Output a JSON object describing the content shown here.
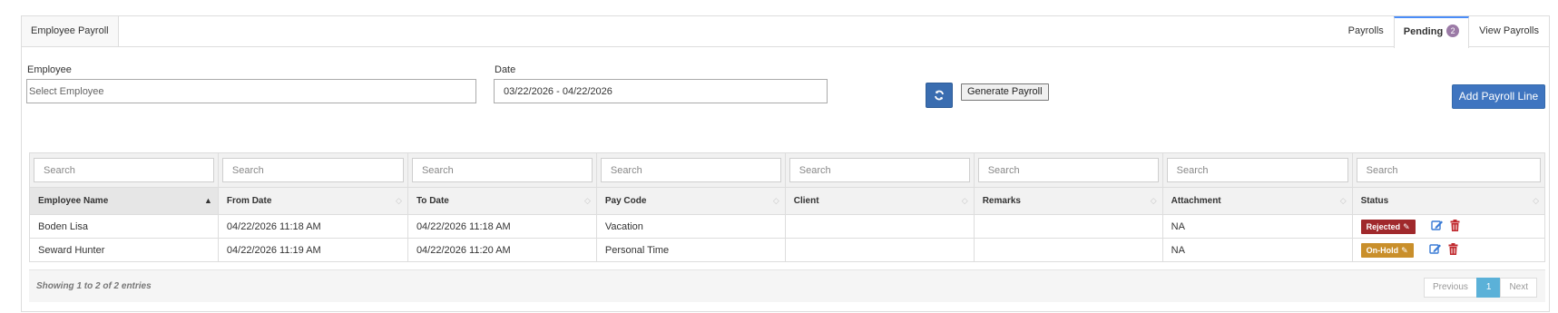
{
  "panel": {
    "title": "Employee Payroll",
    "tabs": [
      {
        "label": "Payrolls"
      },
      {
        "label": "Pending",
        "badge": "2"
      },
      {
        "label": "View Payrolls"
      }
    ]
  },
  "filters": {
    "employee_label": "Employee",
    "employee_placeholder": "Select Employee",
    "date_label": "Date",
    "date_value": "03/22/2026 - 04/22/2026",
    "generate_label": "Generate Payroll",
    "add_label": "Add Payroll Line"
  },
  "table": {
    "search_placeholder": "Search",
    "columns": [
      "Employee Name",
      "From Date",
      "To Date",
      "Pay Code",
      "Client",
      "Remarks",
      "Attachment",
      "Status"
    ],
    "rows": [
      {
        "employee": "Boden Lisa",
        "from": "04/22/2026 11:18 AM",
        "to": "04/22/2026 11:18 AM",
        "paycode": "Vacation",
        "client": "",
        "remarks": "",
        "attachment": "NA",
        "status": "Rejected",
        "status_color": "#a0292c"
      },
      {
        "employee": "Seward Hunter",
        "from": "04/22/2026 11:19 AM",
        "to": "04/22/2026 11:20 AM",
        "paycode": "Personal Time",
        "client": "",
        "remarks": "",
        "attachment": "NA",
        "status": "On-Hold",
        "status_color": "#c98f2b"
      }
    ]
  },
  "footer": {
    "info": "Showing 1 to 2 of 2 entries",
    "previous": "Previous",
    "page": "1",
    "next": "Next"
  },
  "icons": {
    "refresh": "refresh-icon",
    "edit": "edit-icon",
    "delete": "trash-icon",
    "sort": "sort-icon"
  },
  "colors": {
    "primary": "#3f75c0",
    "edit_icon": "#3a7bd5",
    "delete_icon": "#c0282d",
    "badge": "#9b7aa6",
    "page_active": "#5bb1d8"
  }
}
